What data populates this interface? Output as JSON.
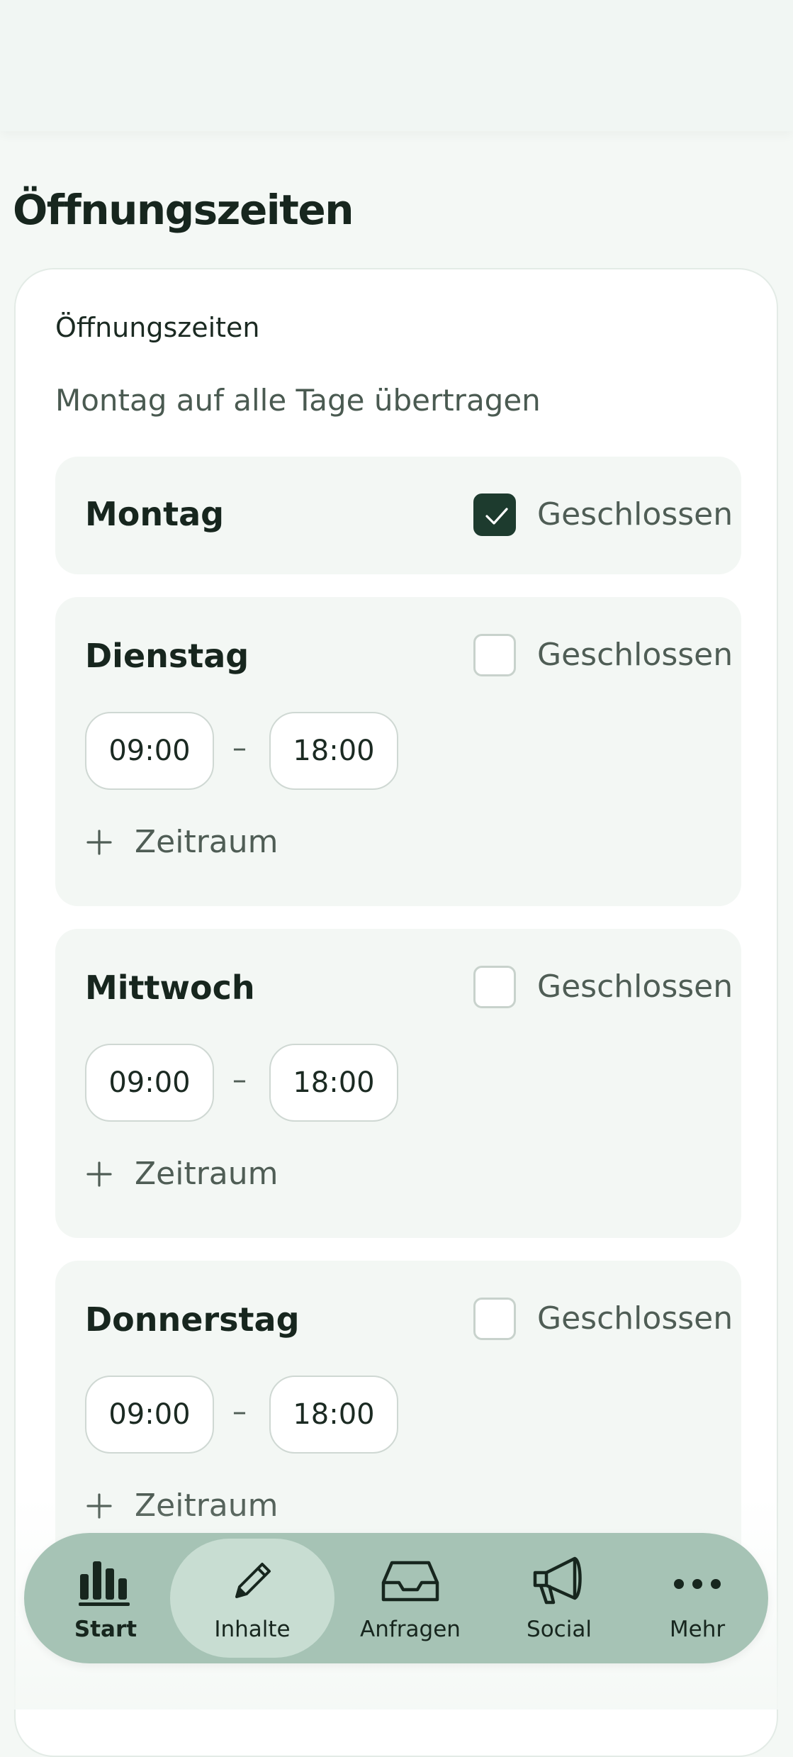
{
  "page": {
    "title": "Öffnungszeiten"
  },
  "card": {
    "title": "Öffnungszeiten",
    "copy_link": "Montag auf alle Tage übertragen"
  },
  "days": [
    {
      "name": "Montag",
      "closed_label": "Geschlossen",
      "closed": true
    },
    {
      "name": "Dienstag",
      "closed_label": "Geschlossen",
      "closed": false,
      "start": "09:00",
      "separator": "–",
      "end": "18:00",
      "add_label": "Zeitraum"
    },
    {
      "name": "Mittwoch",
      "closed_label": "Geschlossen",
      "closed": false,
      "start": "09:00",
      "separator": "–",
      "end": "18:00",
      "add_label": "Zeitraum"
    },
    {
      "name": "Donnerstag",
      "closed_label": "Geschlossen",
      "closed": false,
      "start": "09:00",
      "separator": "–",
      "end": "18:00",
      "add_label": "Zeitraum"
    }
  ],
  "nav": {
    "items": [
      {
        "label": "Start",
        "icon": "bar-chart-icon",
        "active": false
      },
      {
        "label": "Inhalte",
        "icon": "pencil-icon",
        "active": true
      },
      {
        "label": "Anfragen",
        "icon": "inbox-icon",
        "active": false
      },
      {
        "label": "Social",
        "icon": "megaphone-icon",
        "active": false
      },
      {
        "label": "Mehr",
        "icon": "more-icon",
        "active": false
      }
    ]
  },
  "colors": {
    "accent": "#1d3b2e",
    "nav_bg": "#a6c3b5",
    "nav_active": "#c8ddd2",
    "day_bg": "#f3f7f4"
  }
}
